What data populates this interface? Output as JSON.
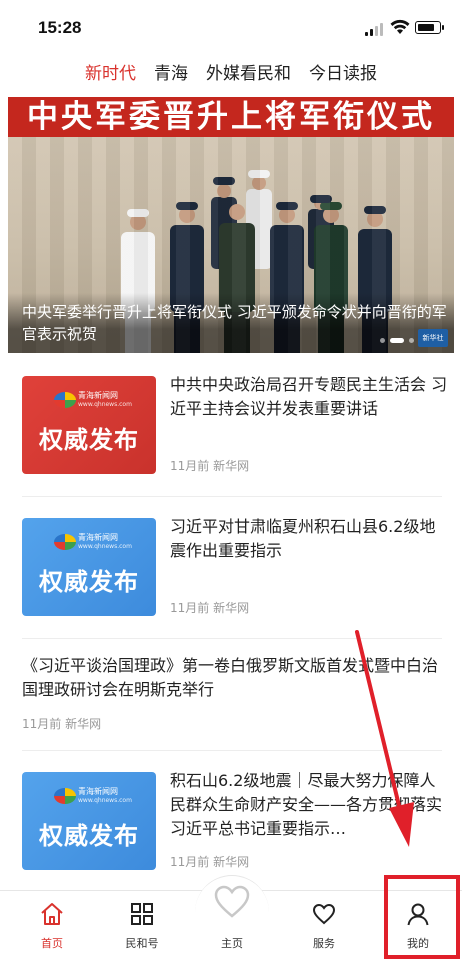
{
  "status_bar": {
    "time": "15:28",
    "battery_level": 0.8
  },
  "top_tabs": [
    {
      "label": "新时代",
      "active": true
    },
    {
      "label": "青海",
      "active": false
    },
    {
      "label": "外媒看民和",
      "active": false
    },
    {
      "label": "今日读报",
      "active": false
    }
  ],
  "banner": {
    "headline": "中央军委晋升上将军衔仪式",
    "caption": "中央军委举行晋升上将军衔仪式 习近平颁发命令状并向晋衔的军官表示祝贺",
    "logo_text": "新华社"
  },
  "news": [
    {
      "title": "中共中央政治局召开专题民主生活会 习近平主持会议并发表重要讲话",
      "meta": "11月前 新华网",
      "thumb": {
        "site": "青海新闻网",
        "url": "www.qhnews.com",
        "label": "权威发布",
        "color": "red"
      }
    },
    {
      "title": "习近平对甘肃临夏州积石山县6.2级地震作出重要指示",
      "meta": "11月前 新华网",
      "thumb": {
        "site": "青海新闻网",
        "url": "www.qhnews.com",
        "label": "权威发布",
        "color": "blue"
      }
    },
    {
      "title": "《习近平谈治国理政》第一卷白俄罗斯文版首发式暨中白治国理政研讨会在明斯克举行",
      "meta": "11月前 新华网"
    },
    {
      "title": "积石山6.2级地震｜尽最大努力保障人民群众生命财产安全——各方贯彻落实习近平总书记重要指示…",
      "meta": "11月前 新华网",
      "thumb": {
        "site": "青海新闻网",
        "url": "www.qhnews.com",
        "label": "权威发布",
        "color": "blue"
      }
    }
  ],
  "bottom_nav": [
    {
      "label": "首页",
      "icon": "home-icon",
      "active": true
    },
    {
      "label": "民和号",
      "icon": "grid-icon",
      "active": false
    },
    {
      "label": "主页",
      "icon": "heart-outline-icon",
      "active": false
    },
    {
      "label": "服务",
      "icon": "heart-icon",
      "active": false
    },
    {
      "label": "我的",
      "icon": "user-icon",
      "active": false
    }
  ],
  "colors": {
    "accent": "#d9322d",
    "annotation": "#e0202a"
  }
}
